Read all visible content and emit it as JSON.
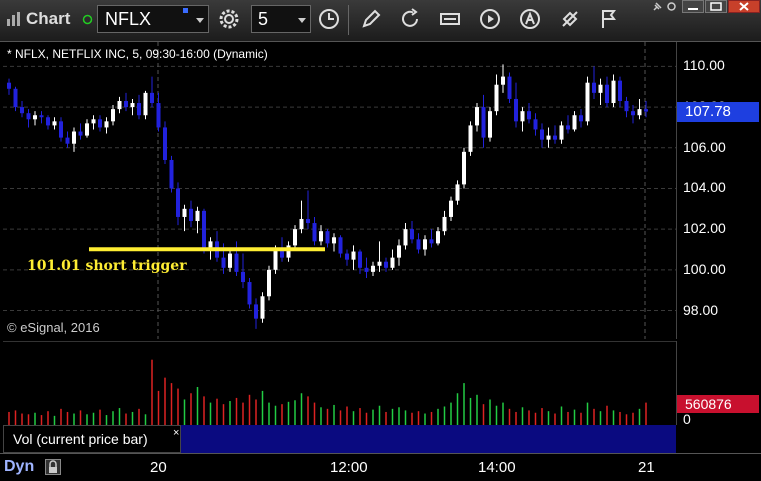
{
  "toolbar": {
    "title": "Chart",
    "symbol": "NFLX",
    "interval": "5",
    "icons": [
      "gear-icon",
      "clock-icon",
      "pencil-icon",
      "refresh-icon",
      "quote-icon",
      "play-icon",
      "alert-icon",
      "link-icon",
      "flag-icon",
      "pin-icon"
    ]
  },
  "chart": {
    "header": "* NFLX, NETFLIX INC, 5, 09:30-16:00 (Dynamic)",
    "copyright": "© eSignal, 2016",
    "annotation": "101.01 short trigger",
    "annotation_color": "#ffee33",
    "up_color": "#ffffff",
    "down_color": "#2222dd",
    "last_price": "107.78",
    "last_price_color": "#1e3fe0"
  },
  "volume": {
    "label": "Vol (current price bar)",
    "close": "×",
    "last_value": "560876",
    "zero_label": "0",
    "up_color": "#22cc44",
    "down_color": "#dd2222"
  },
  "time_axis": {
    "mode": "Dyn",
    "labels": [
      "20",
      "12:00",
      "14:00",
      "21"
    ]
  },
  "chart_data": {
    "type": "candlestick",
    "title": "* NFLX, NETFLIX INC, 5, 09:30-16:00 (Dynamic)",
    "y_tick_labels": [
      "110.00",
      "108.00",
      "106.00",
      "104.00",
      "102.00",
      "100.00",
      "98.00"
    ],
    "ylim": [
      96.6,
      111.2
    ],
    "x_tick_labels": [
      "20",
      "12:00",
      "14:00",
      "21"
    ],
    "trigger_level": 101.01,
    "last_price": 107.78,
    "grid": true,
    "candles": [
      [
        109.2,
        109.4,
        108.6,
        108.9
      ],
      [
        108.9,
        109.0,
        107.8,
        108.0
      ],
      [
        108.0,
        108.3,
        107.5,
        107.7
      ],
      [
        107.7,
        107.9,
        107.0,
        107.4
      ],
      [
        107.4,
        107.8,
        107.1,
        107.6
      ],
      [
        107.6,
        107.8,
        107.2,
        107.5
      ],
      [
        107.5,
        107.6,
        106.9,
        107.1
      ],
      [
        107.1,
        107.5,
        106.9,
        107.3
      ],
      [
        107.3,
        107.5,
        106.3,
        106.5
      ],
      [
        106.5,
        106.8,
        106.0,
        106.2
      ],
      [
        106.2,
        107.0,
        105.8,
        106.8
      ],
      [
        106.8,
        107.2,
        106.4,
        106.6
      ],
      [
        106.6,
        107.4,
        106.5,
        107.2
      ],
      [
        107.2,
        107.6,
        106.9,
        107.4
      ],
      [
        107.4,
        107.6,
        106.8,
        107.0
      ],
      [
        107.0,
        107.5,
        106.7,
        107.3
      ],
      [
        107.3,
        108.1,
        107.1,
        107.9
      ],
      [
        107.9,
        108.5,
        107.7,
        108.3
      ],
      [
        108.3,
        108.7,
        107.8,
        108.0
      ],
      [
        108.0,
        108.4,
        107.6,
        108.2
      ],
      [
        108.2,
        108.6,
        107.4,
        107.6
      ],
      [
        107.6,
        108.8,
        107.4,
        108.7
      ],
      [
        108.7,
        109.5,
        108.0,
        108.2
      ],
      [
        108.2,
        108.7,
        106.8,
        107.0
      ],
      [
        107.0,
        107.3,
        105.2,
        105.4
      ],
      [
        105.4,
        105.6,
        103.8,
        104.0
      ],
      [
        104.0,
        104.3,
        102.2,
        102.6
      ],
      [
        102.6,
        103.2,
        101.9,
        103.0
      ],
      [
        103.0,
        103.4,
        102.1,
        102.4
      ],
      [
        102.4,
        103.1,
        101.8,
        102.9
      ],
      [
        102.9,
        103.0,
        100.8,
        101.1
      ],
      [
        101.1,
        101.6,
        100.5,
        101.4
      ],
      [
        101.4,
        101.9,
        100.4,
        100.6
      ],
      [
        100.6,
        101.3,
        99.8,
        100.1
      ],
      [
        100.1,
        101.0,
        99.9,
        100.8
      ],
      [
        100.8,
        101.4,
        99.7,
        99.9
      ],
      [
        99.9,
        100.8,
        99.1,
        99.4
      ],
      [
        99.4,
        99.6,
        98.1,
        98.3
      ],
      [
        98.3,
        98.6,
        97.1,
        97.6
      ],
      [
        97.6,
        98.9,
        97.4,
        98.7
      ],
      [
        98.7,
        100.2,
        98.5,
        100.0
      ],
      [
        100.0,
        101.2,
        99.8,
        101.0
      ],
      [
        101.0,
        101.6,
        100.4,
        100.6
      ],
      [
        100.6,
        101.4,
        100.4,
        101.2
      ],
      [
        101.2,
        102.2,
        101.0,
        102.0
      ],
      [
        102.0,
        103.4,
        101.8,
        102.5
      ],
      [
        102.5,
        103.9,
        102.0,
        102.3
      ],
      [
        102.3,
        102.6,
        101.2,
        101.4
      ],
      [
        101.4,
        102.2,
        101.2,
        101.9
      ],
      [
        101.9,
        102.0,
        101.1,
        101.3
      ],
      [
        101.3,
        101.8,
        100.9,
        101.6
      ],
      [
        101.6,
        101.7,
        100.6,
        100.8
      ],
      [
        100.8,
        101.0,
        100.2,
        100.5
      ],
      [
        100.5,
        101.2,
        100.0,
        100.9
      ],
      [
        100.9,
        101.0,
        99.8,
        100.1
      ],
      [
        100.1,
        100.6,
        99.6,
        99.9
      ],
      [
        99.9,
        100.4,
        99.7,
        100.2
      ],
      [
        100.2,
        101.4,
        99.9,
        100.4
      ],
      [
        100.4,
        100.6,
        99.9,
        100.1
      ],
      [
        100.1,
        101.0,
        100.0,
        100.6
      ],
      [
        100.6,
        101.5,
        100.2,
        101.2
      ],
      [
        101.2,
        102.3,
        101.0,
        102.0
      ],
      [
        102.0,
        102.4,
        101.3,
        101.5
      ],
      [
        101.5,
        101.8,
        100.8,
        101.0
      ],
      [
        101.0,
        101.7,
        100.7,
        101.5
      ],
      [
        101.5,
        102.0,
        101.1,
        101.3
      ],
      [
        101.3,
        102.1,
        101.2,
        101.9
      ],
      [
        101.9,
        102.9,
        101.7,
        102.6
      ],
      [
        102.6,
        103.6,
        102.4,
        103.4
      ],
      [
        103.4,
        104.4,
        103.2,
        104.2
      ],
      [
        104.2,
        106.0,
        104.0,
        105.8
      ],
      [
        105.8,
        107.3,
        105.6,
        107.1
      ],
      [
        107.1,
        108.2,
        106.8,
        108.0
      ],
      [
        108.0,
        108.6,
        106.0,
        106.5
      ],
      [
        106.5,
        108.0,
        106.3,
        107.8
      ],
      [
        107.8,
        109.6,
        107.6,
        109.1
      ],
      [
        109.1,
        110.1,
        108.7,
        109.5
      ],
      [
        109.5,
        109.7,
        108.2,
        108.4
      ],
      [
        108.4,
        109.2,
        107.0,
        107.3
      ],
      [
        107.3,
        108.0,
        106.8,
        107.8
      ],
      [
        107.8,
        108.2,
        107.2,
        107.4
      ],
      [
        107.4,
        107.7,
        106.6,
        106.9
      ],
      [
        106.9,
        107.2,
        106.0,
        106.4
      ],
      [
        106.4,
        107.0,
        106.0,
        106.6
      ],
      [
        106.6,
        107.1,
        106.2,
        106.4
      ],
      [
        106.4,
        107.3,
        106.2,
        107.1
      ],
      [
        107.1,
        107.6,
        106.7,
        106.9
      ],
      [
        106.9,
        107.8,
        106.8,
        107.6
      ],
      [
        107.6,
        107.9,
        107.0,
        107.3
      ],
      [
        107.3,
        109.5,
        107.1,
        109.2
      ],
      [
        109.2,
        110.0,
        108.4,
        108.7
      ],
      [
        108.7,
        109.4,
        108.1,
        109.1
      ],
      [
        109.1,
        109.5,
        108.0,
        108.2
      ],
      [
        108.2,
        109.6,
        108.0,
        109.3
      ],
      [
        109.3,
        109.5,
        108.0,
        108.3
      ],
      [
        108.3,
        108.5,
        107.5,
        107.8
      ],
      [
        107.8,
        108.1,
        107.2,
        107.6
      ],
      [
        107.6,
        108.4,
        107.4,
        107.9
      ],
      [
        107.9,
        108.3,
        107.5,
        107.78
      ]
    ],
    "volume": [
      0.18,
      0.2,
      0.16,
      0.15,
      0.17,
      0.14,
      0.19,
      0.13,
      0.22,
      0.18,
      0.16,
      0.2,
      0.15,
      0.17,
      0.21,
      0.14,
      0.19,
      0.23,
      0.16,
      0.18,
      0.22,
      0.15,
      0.85,
      0.45,
      0.62,
      0.55,
      0.48,
      0.34,
      0.42,
      0.5,
      0.38,
      0.3,
      0.35,
      0.28,
      0.32,
      0.36,
      0.3,
      0.4,
      0.34,
      0.45,
      0.3,
      0.26,
      0.28,
      0.31,
      0.33,
      0.42,
      0.38,
      0.3,
      0.24,
      0.22,
      0.27,
      0.2,
      0.25,
      0.19,
      0.23,
      0.17,
      0.21,
      0.26,
      0.18,
      0.22,
      0.24,
      0.2,
      0.17,
      0.19,
      0.16,
      0.18,
      0.22,
      0.25,
      0.3,
      0.42,
      0.55,
      0.36,
      0.4,
      0.28,
      0.34,
      0.26,
      0.3,
      0.22,
      0.18,
      0.24,
      0.2,
      0.17,
      0.23,
      0.19,
      0.16,
      0.25,
      0.18,
      0.21,
      0.17,
      0.3,
      0.22,
      0.19,
      0.26,
      0.2,
      0.18,
      0.15,
      0.17,
      0.22,
      0.3
    ]
  }
}
